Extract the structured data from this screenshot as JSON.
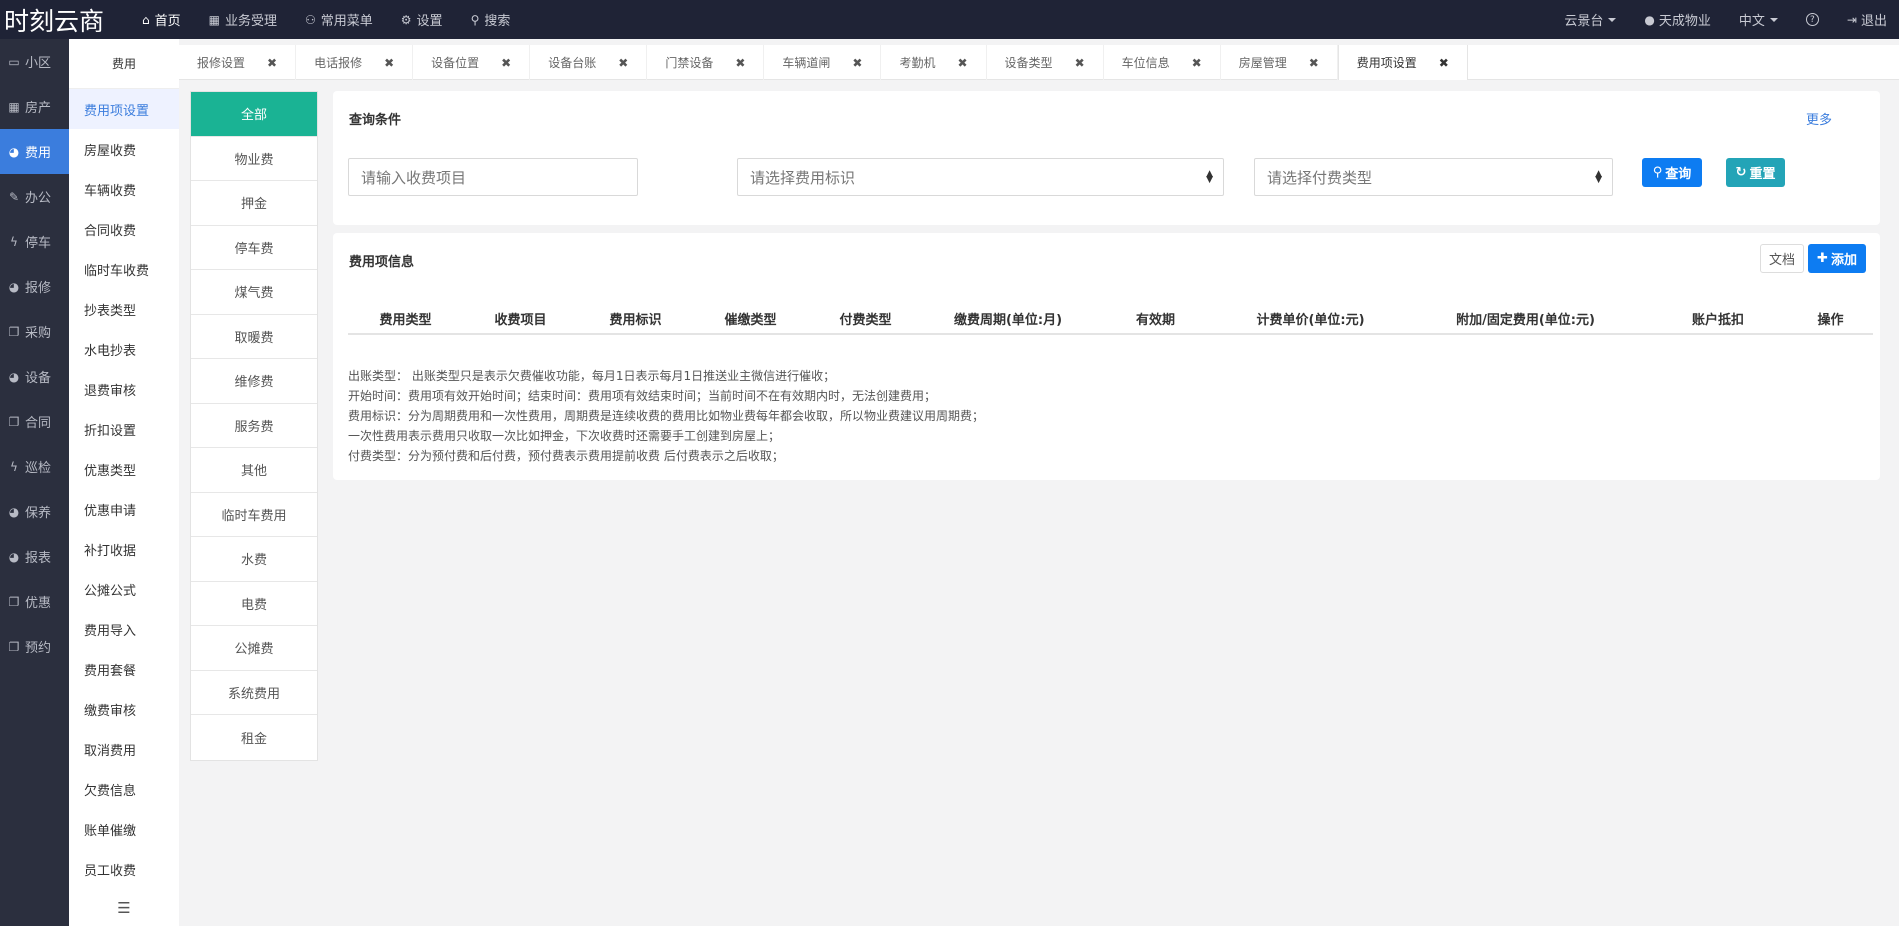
{
  "app": {
    "title": "时刻云商"
  },
  "topnav": [
    {
      "icon": "home-icon",
      "glyph": "⌂",
      "label": "首页",
      "active": true
    },
    {
      "icon": "calculator-icon",
      "glyph": "▦",
      "label": "业务受理"
    },
    {
      "icon": "sitemap-icon",
      "glyph": "⚇",
      "label": "常用菜单"
    },
    {
      "icon": "gear-icon",
      "glyph": "⚙",
      "label": "设置"
    },
    {
      "icon": "search-icon",
      "glyph": "⚲",
      "label": "搜索"
    }
  ],
  "topright": {
    "community": "云景台",
    "user": "天成物业",
    "language": "中文",
    "help": "?",
    "logout": "退出"
  },
  "rail": [
    {
      "icon": "laptop-icon",
      "glyph": "▭",
      "label": "小区"
    },
    {
      "icon": "grid-icon",
      "glyph": "▦",
      "label": "房产"
    },
    {
      "icon": "globe-icon",
      "glyph": "◕",
      "label": "费用",
      "active": true
    },
    {
      "icon": "edit-icon",
      "glyph": "✎",
      "label": "办公"
    },
    {
      "icon": "bolt-icon",
      "glyph": "ϟ",
      "label": "停车"
    },
    {
      "icon": "globe-icon",
      "glyph": "◕",
      "label": "报修"
    },
    {
      "icon": "copy-icon",
      "glyph": "❐",
      "label": "采购"
    },
    {
      "icon": "globe-icon",
      "glyph": "◕",
      "label": "设备"
    },
    {
      "icon": "copy-icon",
      "glyph": "❐",
      "label": "合同"
    },
    {
      "icon": "bolt-icon",
      "glyph": "ϟ",
      "label": "巡检"
    },
    {
      "icon": "globe-icon",
      "glyph": "◕",
      "label": "保养"
    },
    {
      "icon": "globe-icon",
      "glyph": "◕",
      "label": "报表"
    },
    {
      "icon": "copy-icon",
      "glyph": "❐",
      "label": "优惠"
    },
    {
      "icon": "copy-icon",
      "glyph": "❐",
      "label": "预约"
    }
  ],
  "submenu": {
    "header": "费用",
    "items": [
      "费用项设置",
      "房屋收费",
      "车辆收费",
      "合同收费",
      "临时车收费",
      "抄表类型",
      "水电抄表",
      "退费审核",
      "折扣设置",
      "优惠类型",
      "优惠申请",
      "补打收据",
      "公摊公式",
      "费用导入",
      "费用套餐",
      "缴费审核",
      "取消费用",
      "欠费信息",
      "账单催缴",
      "员工收费"
    ],
    "active_index": 0,
    "collapse_glyph": "☰"
  },
  "tabs": [
    {
      "label": "报修设置"
    },
    {
      "label": "电话报修"
    },
    {
      "label": "设备位置"
    },
    {
      "label": "设备台账"
    },
    {
      "label": "门禁设备"
    },
    {
      "label": "车辆道闸"
    },
    {
      "label": "考勤机"
    },
    {
      "label": "设备类型"
    },
    {
      "label": "车位信息"
    },
    {
      "label": "房屋管理"
    },
    {
      "label": "费用项设置",
      "active": true
    }
  ],
  "tab_close": "✖",
  "categories": [
    "全部",
    "物业费",
    "押金",
    "停车费",
    "煤气费",
    "取暖费",
    "维修费",
    "服务费",
    "其他",
    "临时车费用",
    "水费",
    "电费",
    "公摊费",
    "系统费用",
    "租金"
  ],
  "query": {
    "title": "查询条件",
    "more": "更多",
    "item_placeholder": "请输入收费项目",
    "fee_flag_select": "请选择费用标识",
    "pay_type_select": "请选择付费类型",
    "search_btn": "查询",
    "reset_btn": "重置"
  },
  "info": {
    "title": "费用项信息",
    "doc_btn": "文档",
    "add_btn": "添加",
    "columns": [
      "费用类型",
      "收费项目",
      "费用标识",
      "催缴类型",
      "付费类型",
      "缴费周期(单位:月)",
      "有效期",
      "计费单价(单位:元)",
      "附加/固定费用(单位:元)",
      "账户抵扣",
      "操作"
    ],
    "notes": [
      "出账类型： 出账类型只是表示欠费催收功能，每月1日表示每月1日推送业主微信进行催收；",
      "开始时间：费用项有效开始时间；结束时间：费用项有效结束时间；当前时间不在有效期内时，无法创建费用；",
      "费用标识：分为周期费用和一次性费用，周期费是连续收费的费用比如物业费每年都会收取，所以物业费建议用周期费；",
      "一次性费用表示费用只收取一次比如押金，下次收费时还需要手工创建到房屋上；",
      "付费类型：分为预付费和后付费，预付费表示费用提前收费 后付费表示之后收取；"
    ]
  },
  "colors": {
    "topbar": "#1f2336",
    "rail": "#2b2f3e",
    "accent": "#3b7ddd",
    "category_active": "#1ab394",
    "search_btn": "#0d7cf2",
    "reset_btn": "#23a4b7"
  }
}
